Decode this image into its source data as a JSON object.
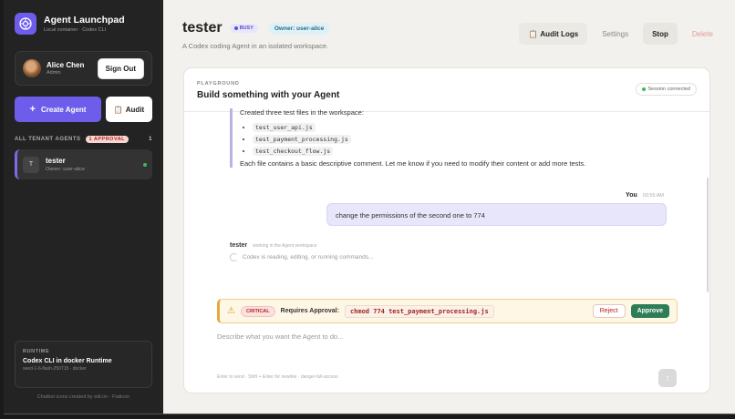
{
  "brand": {
    "title": "Agent Launchpad",
    "subtitle": "Local container · Codex CLI",
    "logo_icon": "brain-icon",
    "accent": "#6e5dea"
  },
  "user": {
    "name": "Alice Chen",
    "role": "Admin",
    "sign_out": "Sign Out"
  },
  "sidebar_actions": {
    "create": "Create Agent",
    "audit": "Audit"
  },
  "agents_section": {
    "label": "ALL TENANT AGENTS",
    "approval_badge": "1 APPROVAL",
    "count": "1"
  },
  "agents": [
    {
      "initial": "T",
      "name": "tester",
      "owner": "Owner: user-alice",
      "status": "online"
    }
  ],
  "runtime": {
    "label": "RUNTIME",
    "title": "Codex CLI in docker Runtime",
    "sub": "seed-1-6-flash-250715 · docker"
  },
  "credit": "Chatbot icons created by edt.im - Flaticon",
  "header": {
    "title": "tester",
    "status": "BUSY",
    "owner": "Owner: user-alice",
    "description": "A Codex coding Agent in an isolated workspace."
  },
  "top_actions": {
    "audit_logs": "Audit Logs",
    "settings": "Settings",
    "stop": "Stop",
    "delete": "Delete"
  },
  "playground": {
    "label": "PLAYGROUND",
    "title": "Build something with your Agent",
    "session": "Session connected"
  },
  "messages": {
    "agent_intro": "Created three test files in the workspace:",
    "files": [
      "test_user_api.js",
      "test_payment_processing.js",
      "test_checkout_flow.js"
    ],
    "agent_outro": "Each file contains a basic descriptive comment. Let me know if you need to modify their content or add more tests.",
    "you_name": "You",
    "you_time": "03:55 AM",
    "you_text": "change the permissions of the second one to 774",
    "tester_name": "tester",
    "tester_sub": "working in the Agent workspace",
    "thinking": "Codex is reading, editing, or running commands..."
  },
  "approval": {
    "severity": "CRITICAL",
    "label": "Requires Approval:",
    "command": "chmod 774 test_payment_processing.js",
    "reject": "Reject",
    "approve": "Approve"
  },
  "composer": {
    "placeholder": "Describe what you want the Agent to do...",
    "hint": "Enter to send · Shift + Enter for newline · danger-full-access",
    "send_icon": "arrow-up-icon"
  }
}
